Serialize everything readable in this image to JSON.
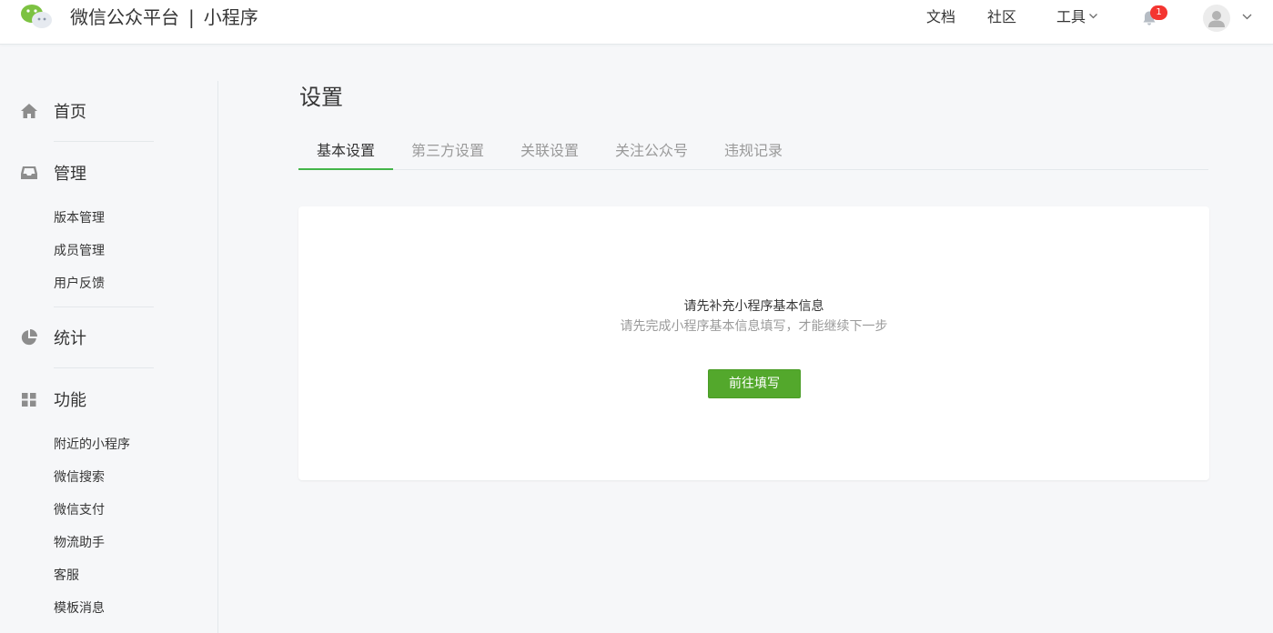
{
  "header": {
    "brand_main": "微信公众平台",
    "brand_sep": "|",
    "brand_sub": "小程序",
    "nav": {
      "docs": "文档",
      "community": "社区",
      "tools": "工具"
    },
    "notification_count": "1",
    "icons": {
      "logo": "wechat-logo-icon",
      "bell": "bell-icon",
      "avatar": "user-avatar-icon",
      "chevron": "chevron-down-icon"
    }
  },
  "sidebar": {
    "home": {
      "label": "首页",
      "icon": "home-icon"
    },
    "manage": {
      "label": "管理",
      "icon": "inbox-icon",
      "items": [
        "版本管理",
        "成员管理",
        "用户反馈"
      ]
    },
    "stats": {
      "label": "统计",
      "icon": "pie-chart-icon"
    },
    "features": {
      "label": "功能",
      "icon": "grid-icon",
      "items": [
        "附近的小程序",
        "微信搜索",
        "微信支付",
        "物流助手",
        "客服",
        "模板消息"
      ]
    }
  },
  "main": {
    "title": "设置",
    "tabs": [
      "基本设置",
      "第三方设置",
      "关联设置",
      "关注公众号",
      "违规记录"
    ],
    "active_tab": "基本设置",
    "card": {
      "title": "请先补充小程序基本信息",
      "subtitle": "请先完成小程序基本信息填写，才能继续下一步",
      "button": "前往填写"
    }
  },
  "colors": {
    "accent": "#44b549",
    "button": "#53a82c",
    "badge": "#f43530",
    "muted_text": "#9a9a9a",
    "text": "#353535",
    "background": "#f6f7f9"
  }
}
